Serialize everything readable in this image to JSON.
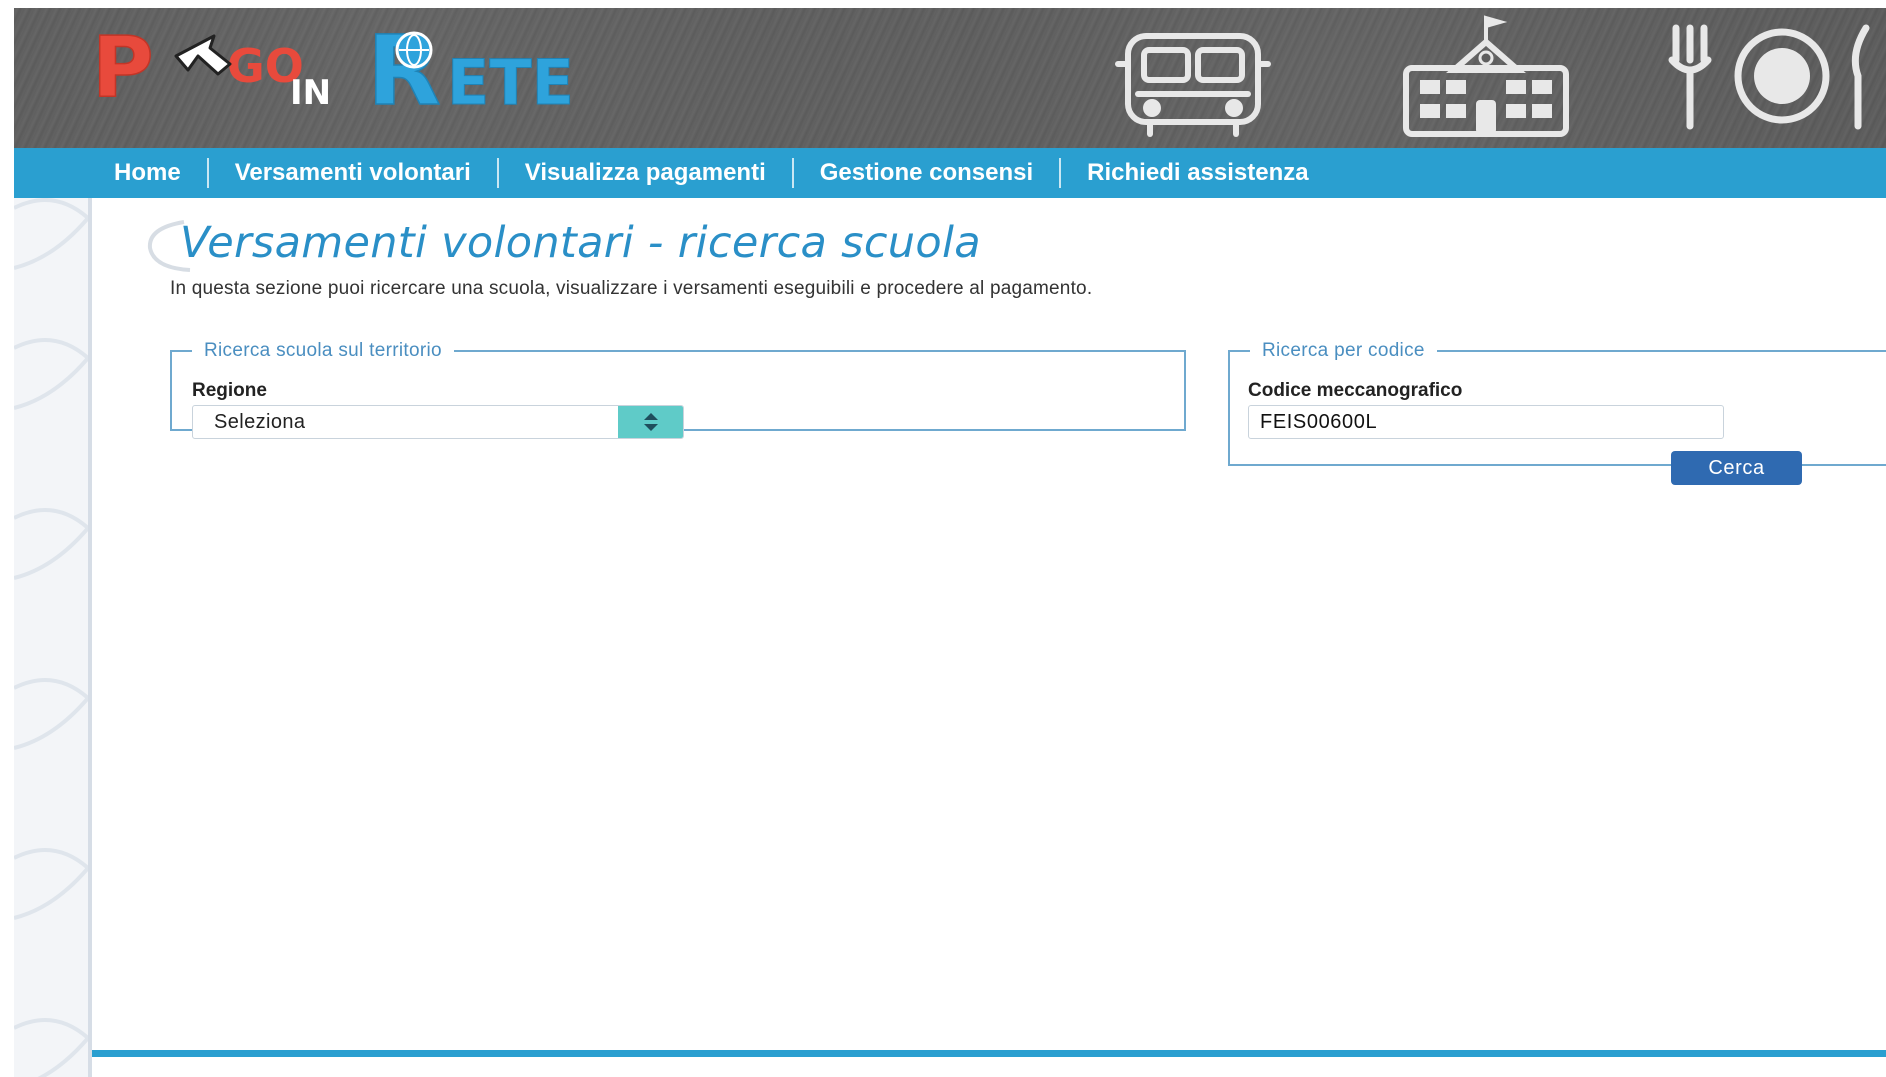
{
  "header": {
    "logo_text": "PAGO IN RETE",
    "logo_parts": [
      "P",
      "GO",
      "IN",
      "R",
      "ETE"
    ],
    "banner_icons": [
      "school-bus-icon",
      "school-building-icon",
      "fork-plate-icon"
    ]
  },
  "nav": {
    "items": [
      {
        "label": "Home"
      },
      {
        "label": "Versamenti volontari"
      },
      {
        "label": "Visualizza pagamenti"
      },
      {
        "label": "Gestione consensi"
      },
      {
        "label": "Richiedi assistenza"
      }
    ]
  },
  "main": {
    "title": "Versamenti volontari - ricerca scuola",
    "intro": "In questa sezione puoi ricercare una scuola, visualizzare i versamenti eseguibili e procedere al pagamento."
  },
  "search_territory": {
    "legend": "Ricerca scuola sul territorio",
    "region_label": "Regione",
    "region_value": "Seleziona"
  },
  "search_code": {
    "legend": "Ricerca per codice",
    "code_label": "Codice meccanografico",
    "code_value": "FEIS00600L",
    "button_label": "Cerca"
  },
  "colors": {
    "nav_bar": "#2a9fd0",
    "title": "#2a8fc7",
    "button": "#2f6ab1",
    "select_arrow": "#5fcbc8",
    "logo_red": "#e84a3c",
    "logo_blue": "#2ea3dc"
  }
}
